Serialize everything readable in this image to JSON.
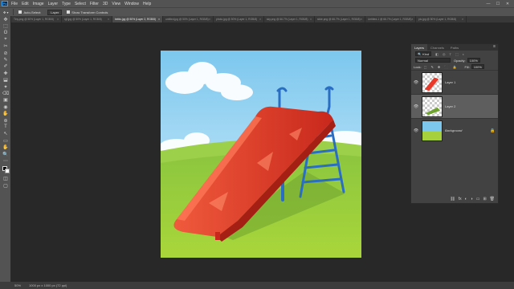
{
  "menubar": {
    "logo": "Ps",
    "items": [
      "File",
      "Edit",
      "Image",
      "Layer",
      "Type",
      "Select",
      "Filter",
      "3D",
      "View",
      "Window",
      "Help"
    ],
    "controls": [
      "—",
      "☐",
      "✕"
    ]
  },
  "options": {
    "auto_select_label": "Auto-Select:",
    "auto_select_value": "Layer",
    "transform_label": "Show Transform Controls"
  },
  "tabs": [
    {
      "title": "Tiny.png @ 50% (Layer 1, RGB/8)",
      "active": false
    },
    {
      "title": "rgf.jpg @ 50% (Layer 1, RGB/8)",
      "active": false
    },
    {
      "title": "bebio.jpg @ 50% (Layer 2, RGB/8)",
      "active": true
    },
    {
      "title": "untitled.jpg @ 50% (Layer 1, RGB/8)",
      "active": false
    },
    {
      "title": "photo.jpg @ 50% (Layer 1, RGB/8)",
      "active": false
    },
    {
      "title": "sky.png @ 66.7% (Layer 1, RGB/8)",
      "active": false
    },
    {
      "title": "slide.png @ 66.7% (Layer 1, RGB/8)",
      "active": false
    },
    {
      "title": "Untitled-1 @ 66.7% (Layer 1, RGB/8)",
      "active": false
    },
    {
      "title": "pic.jpg @ 50% (Layer 1, RGB/8)",
      "active": false
    }
  ],
  "tools": [
    "✥",
    "⬚",
    "ʘ",
    "⌖",
    "✂",
    "⊘",
    "✎",
    "✐",
    "✚",
    "⬓",
    "✦",
    "⌫",
    "▣",
    "◉",
    "✋",
    "⊕",
    "T",
    "↖",
    "▭",
    "✋",
    "🔍",
    "⋯"
  ],
  "layers_panel": {
    "tabs": [
      "Layers",
      "Channels",
      "Paths"
    ],
    "menu_icon": "≡",
    "filter_label": "Kind",
    "filter_icons": "◧ ◎ T ⬚ ◐",
    "blend_mode": "Normal",
    "opacity_label": "Opacity:",
    "opacity_value": "100%",
    "lock_label": "Lock:",
    "lock_icons": "⬚ ✎ ✥ ⬛ 🔒",
    "fill_label": "Fill:",
    "fill_value": "100%",
    "layers": [
      {
        "name": "Layer 1",
        "selected": false,
        "locked": false,
        "italic": false
      },
      {
        "name": "Layer 2",
        "selected": true,
        "locked": false,
        "italic": false
      },
      {
        "name": "Background",
        "selected": false,
        "locked": true,
        "italic": true
      }
    ],
    "bottom_icons": [
      "⛓",
      "fx",
      "◐",
      "◑",
      "▭",
      "⊞",
      "🗑"
    ]
  },
  "status": {
    "zoom": "50%",
    "doc_info": "1000 px x 1000 px (72 ppi)"
  },
  "colors": {
    "sky": "#7ec6ec",
    "grass": "#a6d13c",
    "slide_red": "#e8392a",
    "ladder_blue": "#2a6ec4"
  }
}
